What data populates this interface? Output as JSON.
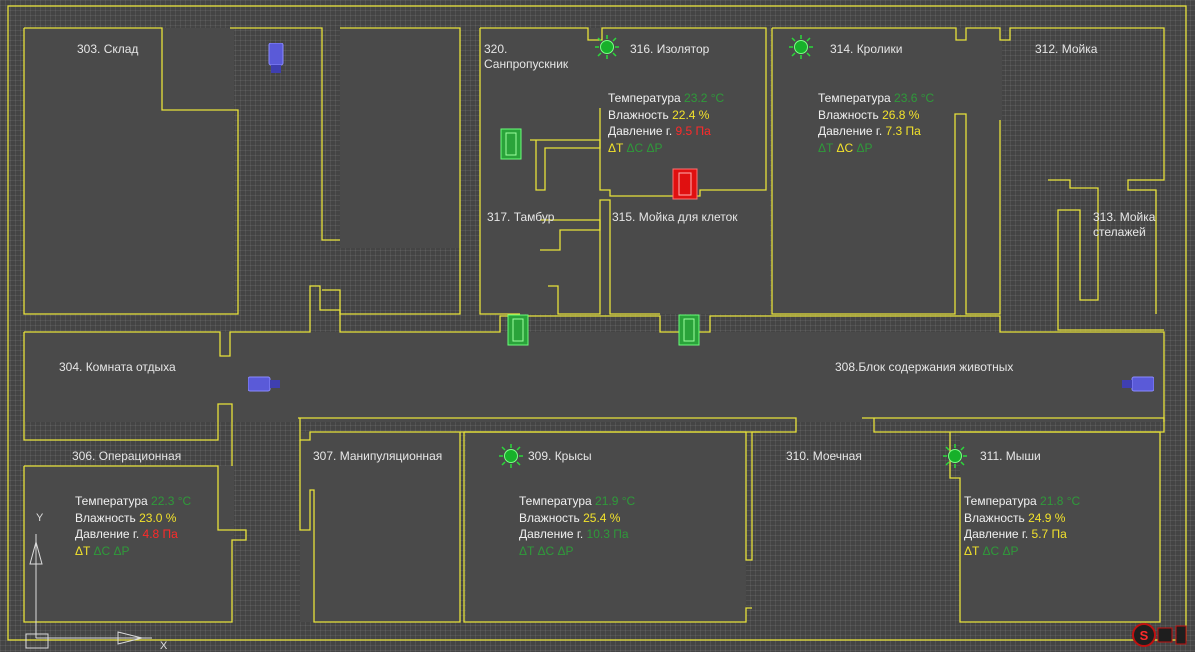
{
  "rooms": {
    "r303": "303. Склад",
    "r320": "320. Санпропускник",
    "r316": "316. Изолятор",
    "r314": "314. Кролики",
    "r312": "312. Мойка",
    "r317": "317. Тамбур",
    "r315": "315. Мойка для клеток",
    "r313": "313. Мойка стелажей",
    "r304": "304. Комната отдыха",
    "r308": "308.Блок содержания животных",
    "r306": "306. Операционная",
    "r307": "307. Манипуляционная",
    "r309": "309. Крысы",
    "r310": "310. Моечная",
    "r311": "311. Мыши"
  },
  "labels": {
    "temperature": "Температура",
    "humidity": "Влажность",
    "pressure": "Давление г.",
    "dT": "ΔT",
    "dC": "ΔC",
    "dP": "ΔP"
  },
  "sensors": {
    "s316": {
      "temp": "23.2 °C",
      "hum": "22.4 %",
      "press": "9.5 Па"
    },
    "s314": {
      "temp": "23.6 °C",
      "hum": "26.8 %",
      "press": "7.3 Па"
    },
    "s306": {
      "temp": "22.3 °C",
      "hum": "23.0 %",
      "press": "4.8 Па"
    },
    "s309": {
      "temp": "21.9 °C",
      "hum": "25.4 %",
      "press": "10.3 Па"
    },
    "s311": {
      "temp": "21.8 °C",
      "hum": "24.9 %",
      "press": "5.7 Па"
    }
  },
  "axis": {
    "y": "Y",
    "x": "X"
  },
  "colors": {
    "wall": "#e8e23a",
    "ok": "#2f9a3a",
    "warn": "#f2e22c",
    "alarm": "#ff2a2a",
    "camera": "#5a5ad8"
  },
  "icons": [
    "lamp-icon",
    "camera-icon",
    "door-icon",
    "alarm-door-icon",
    "status-logo-icon"
  ]
}
